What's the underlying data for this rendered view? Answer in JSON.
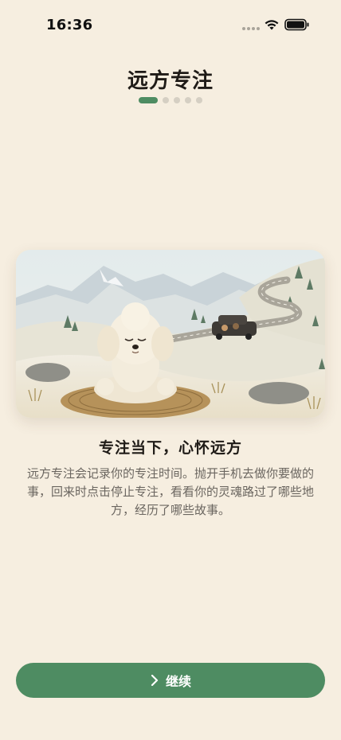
{
  "status_bar": {
    "time": "16:36",
    "icons": [
      "signal-dots-icon",
      "wifi-icon",
      "battery-icon"
    ]
  },
  "header": {
    "title": "远方专注",
    "pager": {
      "total": 5,
      "current": 1
    }
  },
  "illustration": {
    "subject": "poodle-meditating-on-mountain-road-illustration"
  },
  "content": {
    "headline": "专注当下，心怀远方",
    "description": "远方专注会记录你的专注时间。抛开手机去做你要做的事，回来时点击停止专注，看看你的灵魂路过了哪些地方，经历了哪些故事。"
  },
  "footer": {
    "continue_label": "继续",
    "continue_icon": "chevron-right-icon"
  },
  "colors": {
    "background": "#F6EEE0",
    "accent": "#4E8C62",
    "pager_inactive": "#D5CFC3",
    "text_primary": "#1F1B17",
    "text_secondary": "#6B6660"
  }
}
